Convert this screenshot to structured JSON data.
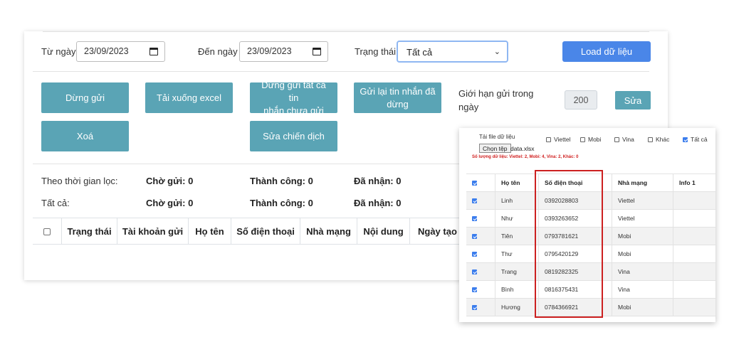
{
  "filters": {
    "from_label": "Từ ngày",
    "from_value": "23/09/2023",
    "to_label": "Đến ngày",
    "to_value": "23/09/2023",
    "status_label": "Trạng thái",
    "status_value": "Tất cả",
    "load_button": "Load dữ liệu"
  },
  "actions": {
    "stop_send": "Dừng gửi",
    "download_excel": "Tải xuống excel",
    "stop_all_line1": "Dừng gửi tất cả tin",
    "stop_all_line2": "nhắn chưa gửi",
    "resend_line1": "Gửi lại tin nhắn đã",
    "resend_line2": "dừng",
    "delete": "Xoá",
    "edit_campaign": "Sửa chiến dịch",
    "limit_label_line1": "Giới hạn gửi trong",
    "limit_label_line2": "ngày",
    "limit_value": "200",
    "edit_button": "Sửa"
  },
  "stats": {
    "filtered_label": "Theo thời gian lọc:",
    "all_label": "Tất cả:",
    "filtered": {
      "pending": "Chờ gửi: 0",
      "success": "Thành công: 0",
      "received": "Đã nhận: 0"
    },
    "all": {
      "pending": "Chờ gửi: 0",
      "success": "Thành công: 0",
      "received": "Đã nhận: 0"
    }
  },
  "main_table": {
    "headers": [
      "Trạng thái",
      "Tài khoản gửi",
      "Họ tên",
      "Số điện thoại",
      "Nhà mạng",
      "Nội dung",
      "Ngày tạo"
    ]
  },
  "upload_panel": {
    "file_label": "Tải file dữ liệu",
    "choose_button": "Chọn tệp",
    "file_name": "data.xlsx",
    "summary": "Số lượng dữ liệu: Viettel: 2, Mobi: 4, Vina: 2, Khác: 0",
    "carrier_filters": [
      {
        "label": "Viettel",
        "checked": false
      },
      {
        "label": "Mobi",
        "checked": false
      },
      {
        "label": "Vina",
        "checked": false
      },
      {
        "label": "Khác",
        "checked": false
      },
      {
        "label": "Tất cả",
        "checked": true
      }
    ],
    "headers": [
      "Họ tên",
      "Số điện thoại",
      "Nhà mạng",
      "Info 1"
    ],
    "rows": [
      {
        "name": "Linh",
        "phone": "0392028803",
        "carrier": "Viettel"
      },
      {
        "name": "Như",
        "phone": "0393263652",
        "carrier": "Viettel"
      },
      {
        "name": "Tiên",
        "phone": "0793781621",
        "carrier": "Mobi"
      },
      {
        "name": "Thư",
        "phone": "0795420129",
        "carrier": "Mobi"
      },
      {
        "name": "Trang",
        "phone": "0819282325",
        "carrier": "Vina"
      },
      {
        "name": "Bình",
        "phone": "0816375431",
        "carrier": "Vina"
      },
      {
        "name": "Hương",
        "phone": "0784366921",
        "carrier": "Mobi"
      }
    ]
  },
  "colors": {
    "action_button": "#5aa4b5",
    "primary_button": "#4a86e8",
    "highlight": "#cc2020"
  }
}
